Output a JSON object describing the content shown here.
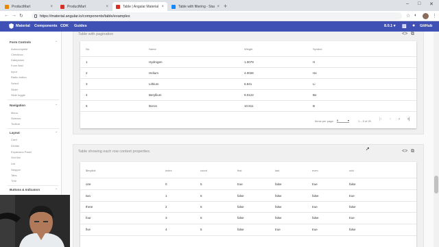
{
  "browser": {
    "tabs": [
      {
        "label": "ProductMart",
        "active": false,
        "color": "#ea8600"
      },
      {
        "label": "ProductMart",
        "active": false,
        "color": "#d93025"
      },
      {
        "label": "Table | Angular Material",
        "active": true,
        "color": "#d93025"
      },
      {
        "label": "Table with filtering - StackBlitz",
        "active": false,
        "color": "#1389fd"
      }
    ],
    "url": "https://material.angular.io/components/table/examples"
  },
  "toolbar": {
    "brand": "Material",
    "nav": [
      "Components",
      "CDK",
      "Guides"
    ],
    "version": "8.0.1",
    "github": "GitHub"
  },
  "sidebar": {
    "sections": [
      {
        "title": "Form Controls",
        "items": [
          "Autocomplete",
          "Checkbox",
          "Datepicker",
          "Form field",
          "Input",
          "Radio button",
          "Select",
          "Slider",
          "Slide toggle"
        ]
      },
      {
        "title": "Navigation",
        "items": [
          "Menu",
          "Sidenav",
          "Toolbar"
        ]
      },
      {
        "title": "Layout",
        "items": [
          "Card",
          "Divider",
          "Expansion Panel",
          "Grid list",
          "List",
          "Stepper",
          "Tabs",
          "Tree"
        ]
      },
      {
        "title": "Buttons & Indicators",
        "items": []
      }
    ]
  },
  "example1": {
    "title": "Table with pagination",
    "columns": [
      "No.",
      "Name",
      "Weight",
      "Symbol"
    ],
    "rows": [
      [
        "1",
        "Hydrogen",
        "1.0079",
        "H"
      ],
      [
        "2",
        "Helium",
        "4.0026",
        "He"
      ],
      [
        "3",
        "Lithium",
        "6.941",
        "Li"
      ],
      [
        "4",
        "Beryllium",
        "9.0122",
        "Be"
      ],
      [
        "5",
        "Boron",
        "10.811",
        "B"
      ]
    ],
    "paginator": {
      "items_per_page_label": "Items per page:",
      "page_size": "5",
      "range": "1 – 5 of 20"
    }
  },
  "example2": {
    "title": "Table showing each row context properties.",
    "columns": [
      "$implicit",
      "index",
      "count",
      "first",
      "last",
      "even",
      "odd"
    ],
    "rows": [
      [
        "one",
        "0",
        "5",
        "true",
        "false",
        "true",
        "false"
      ],
      [
        "two",
        "1",
        "5",
        "false",
        "false",
        "false",
        "true"
      ],
      [
        "three",
        "2",
        "5",
        "false",
        "false",
        "true",
        "false"
      ],
      [
        "four",
        "3",
        "5",
        "false",
        "false",
        "false",
        "true"
      ],
      [
        "five",
        "4",
        "5",
        "false",
        "true",
        "true",
        "false"
      ]
    ]
  },
  "colors": {
    "primary": "#3f51b5"
  }
}
